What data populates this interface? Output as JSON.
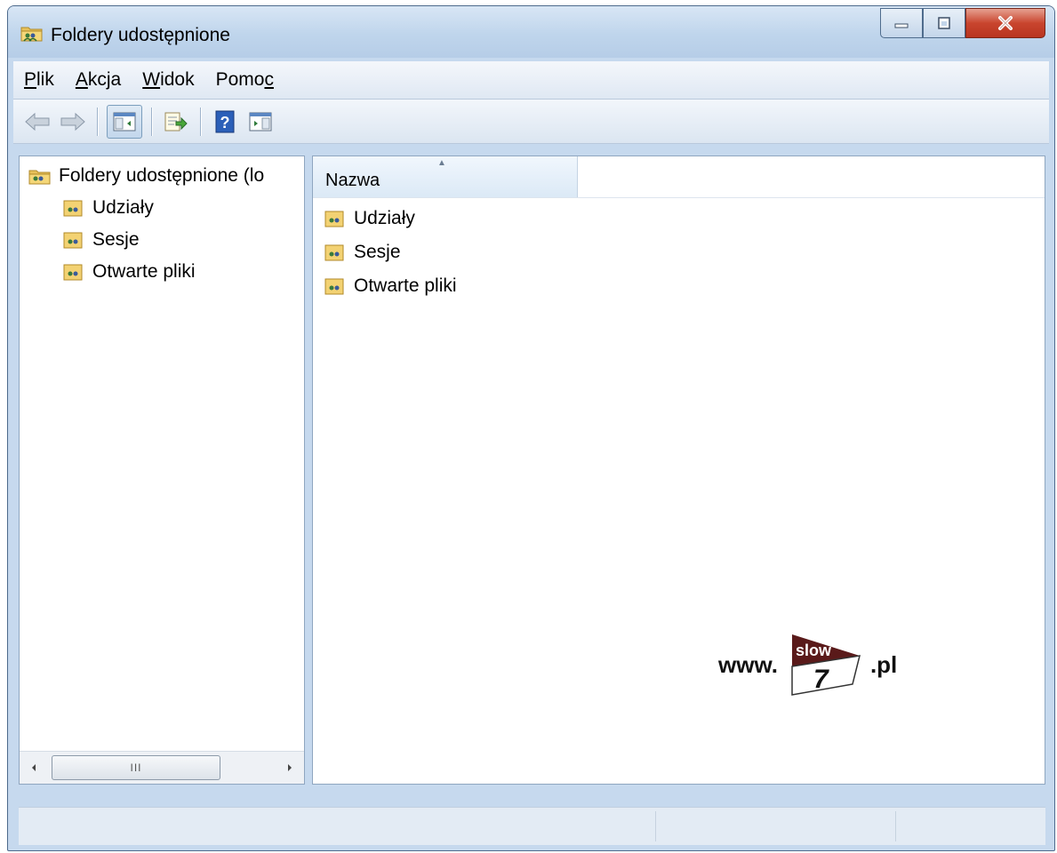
{
  "window": {
    "title": "Foldery udostępnione",
    "icon": "shared-folder-icon"
  },
  "menu": {
    "items": [
      {
        "label": "Plik",
        "mnemonic": "P"
      },
      {
        "label": "Akcja",
        "mnemonic": "A"
      },
      {
        "label": "Widok",
        "mnemonic": "W"
      },
      {
        "label": "Pomoc",
        "mnemonic": "c"
      }
    ]
  },
  "toolbar": {
    "buttons": [
      "back-arrow-icon",
      "forward-arrow-icon",
      "show-hide-console-tree-icon",
      "export-list-icon",
      "help-icon",
      "show-hide-action-pane-icon"
    ]
  },
  "tree": {
    "root_label": "Foldery udostępnione (lo",
    "children": [
      {
        "label": "Udziały"
      },
      {
        "label": "Sesje"
      },
      {
        "label": "Otwarte pliki"
      }
    ]
  },
  "list": {
    "column_name": "Nazwa",
    "sort": "ascending",
    "items": [
      {
        "label": "Udziały"
      },
      {
        "label": "Sesje"
      },
      {
        "label": "Otwarte pliki"
      }
    ]
  },
  "scrollbar": {
    "thumb_grip": "III"
  },
  "watermark": {
    "prefix": "www.",
    "badge_top": "slow",
    "badge_number": "7",
    "suffix": ".pl"
  },
  "colors": {
    "titlebar": "#bfd5ec",
    "close_button": "#c9452e",
    "folder": "#e8c15a",
    "watermark_badge": "#5a1a1a"
  }
}
